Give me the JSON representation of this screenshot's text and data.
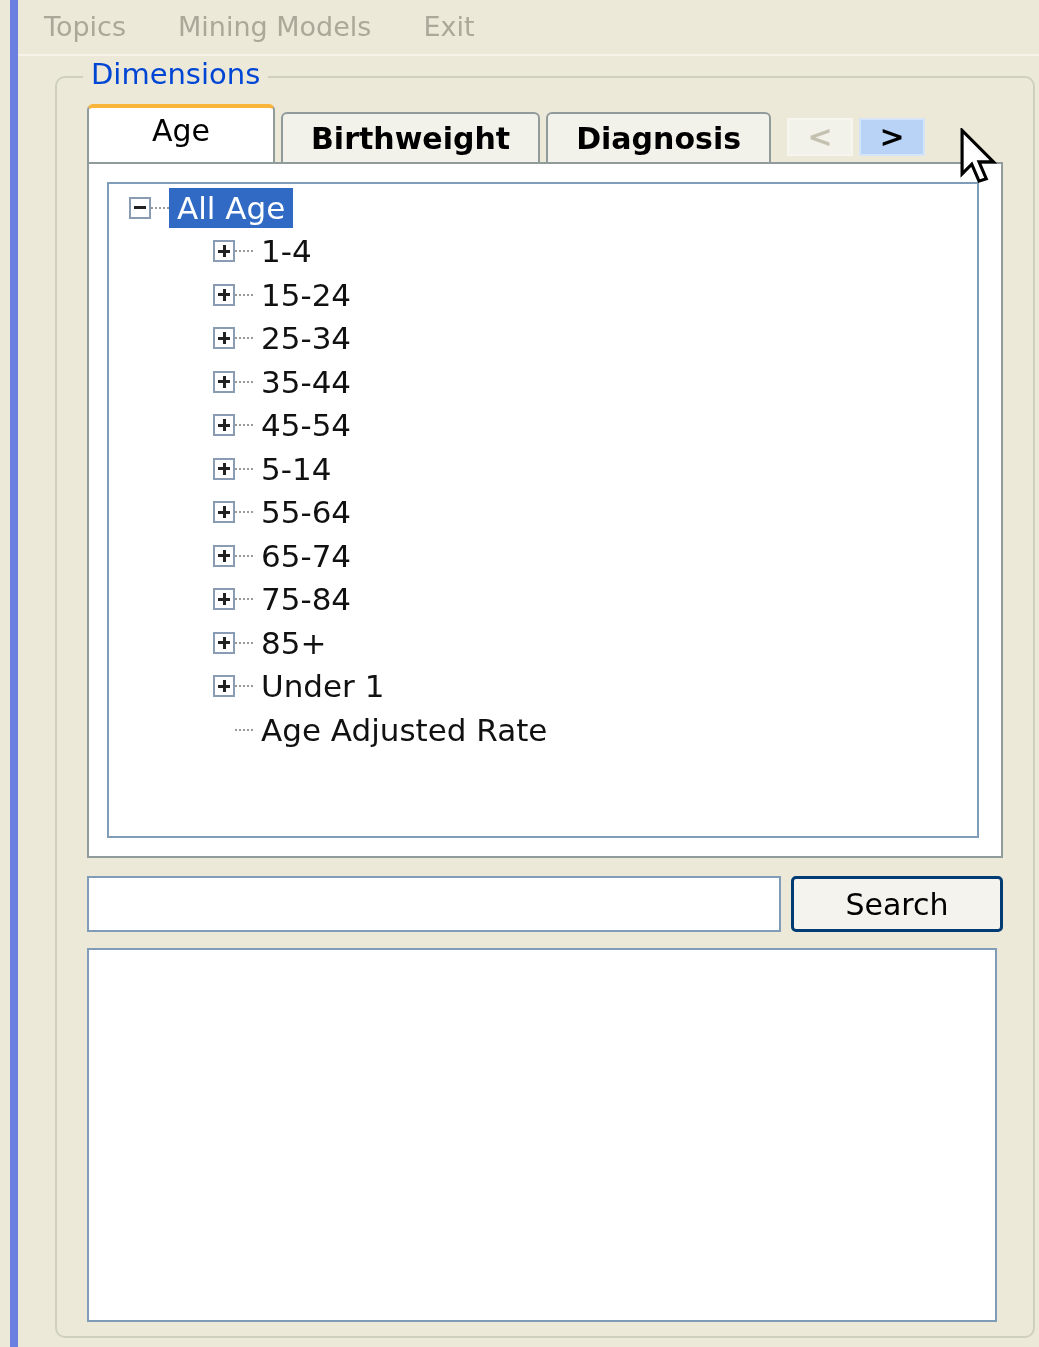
{
  "menu": [
    {
      "label": "Topics",
      "disabled": true
    },
    {
      "label": "Mining Models",
      "disabled": true
    },
    {
      "label": "Exit",
      "disabled": true
    }
  ],
  "group": {
    "title": "Dimensions"
  },
  "tabs": [
    {
      "label": "Age",
      "selected": true
    },
    {
      "label": "Birthweight",
      "selected": false
    },
    {
      "label": "Diagnosis",
      "selected": false
    }
  ],
  "tab_scroll": [
    {
      "label": "<",
      "disabled": true,
      "hovered": false
    },
    {
      "label": ">",
      "disabled": false,
      "hovered": true
    }
  ],
  "tree": [
    {
      "label": "All Age",
      "kind": "group",
      "expanded": true,
      "selected": true,
      "children": [
        {
          "label": "1-4",
          "kind": "group",
          "expanded": false,
          "selected": false
        },
        {
          "label": "15-24",
          "kind": "group",
          "expanded": false,
          "selected": false
        },
        {
          "label": "25-34",
          "kind": "group",
          "expanded": false,
          "selected": false
        },
        {
          "label": "35-44",
          "kind": "group",
          "expanded": false,
          "selected": false
        },
        {
          "label": "45-54",
          "kind": "group",
          "expanded": false,
          "selected": false
        },
        {
          "label": "5-14",
          "kind": "group",
          "expanded": false,
          "selected": false
        },
        {
          "label": "55-64",
          "kind": "group",
          "expanded": false,
          "selected": false
        },
        {
          "label": "65-74",
          "kind": "group",
          "expanded": false,
          "selected": false
        },
        {
          "label": "75-84",
          "kind": "group",
          "expanded": false,
          "selected": false
        },
        {
          "label": "85+",
          "kind": "group",
          "expanded": false,
          "selected": false
        },
        {
          "label": "Under 1",
          "kind": "group",
          "expanded": false,
          "selected": false
        },
        {
          "label": "Age Adjusted Rate",
          "kind": "leaf",
          "selected": false
        }
      ]
    }
  ],
  "search_button": {
    "label": "Search"
  }
}
